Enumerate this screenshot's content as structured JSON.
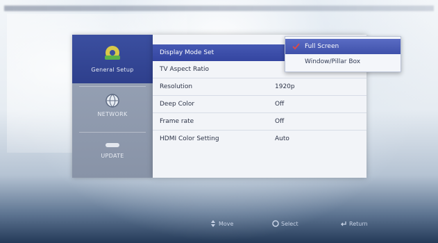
{
  "sidebar": {
    "items": [
      {
        "label": "General Setup",
        "icon": "gear-wrench-icon",
        "active": true
      },
      {
        "label": "NETWORK",
        "icon": "globe-icon",
        "active": false
      },
      {
        "label": "UPDATE",
        "icon": "update-icon",
        "active": false
      }
    ]
  },
  "settings": {
    "rows": [
      {
        "label": "Display Mode Set",
        "value": "",
        "highlighted": true
      },
      {
        "label": "TV Aspect Ratio",
        "value": "",
        "highlighted": false
      },
      {
        "label": "Resolution",
        "value": "1920p",
        "highlighted": false
      },
      {
        "label": "Deep Color",
        "value": "Off",
        "highlighted": false
      },
      {
        "label": "Frame rate",
        "value": "Off",
        "highlighted": false
      },
      {
        "label": "HDMI Color Setting",
        "value": "Auto",
        "highlighted": false
      }
    ]
  },
  "dropdown": {
    "options": [
      {
        "label": "Full Screen",
        "selected": true
      },
      {
        "label": "Window/Pillar Box",
        "selected": false
      }
    ]
  },
  "footer": {
    "hints": [
      {
        "icon": "move-arrows-icon",
        "label": "Move"
      },
      {
        "icon": "select-icon",
        "label": "Select"
      },
      {
        "icon": "return-icon",
        "label": "Return"
      }
    ]
  },
  "colors": {
    "highlight": "#3445a0",
    "panel": "#f2f4f8",
    "sidebar": "#8893a7"
  }
}
